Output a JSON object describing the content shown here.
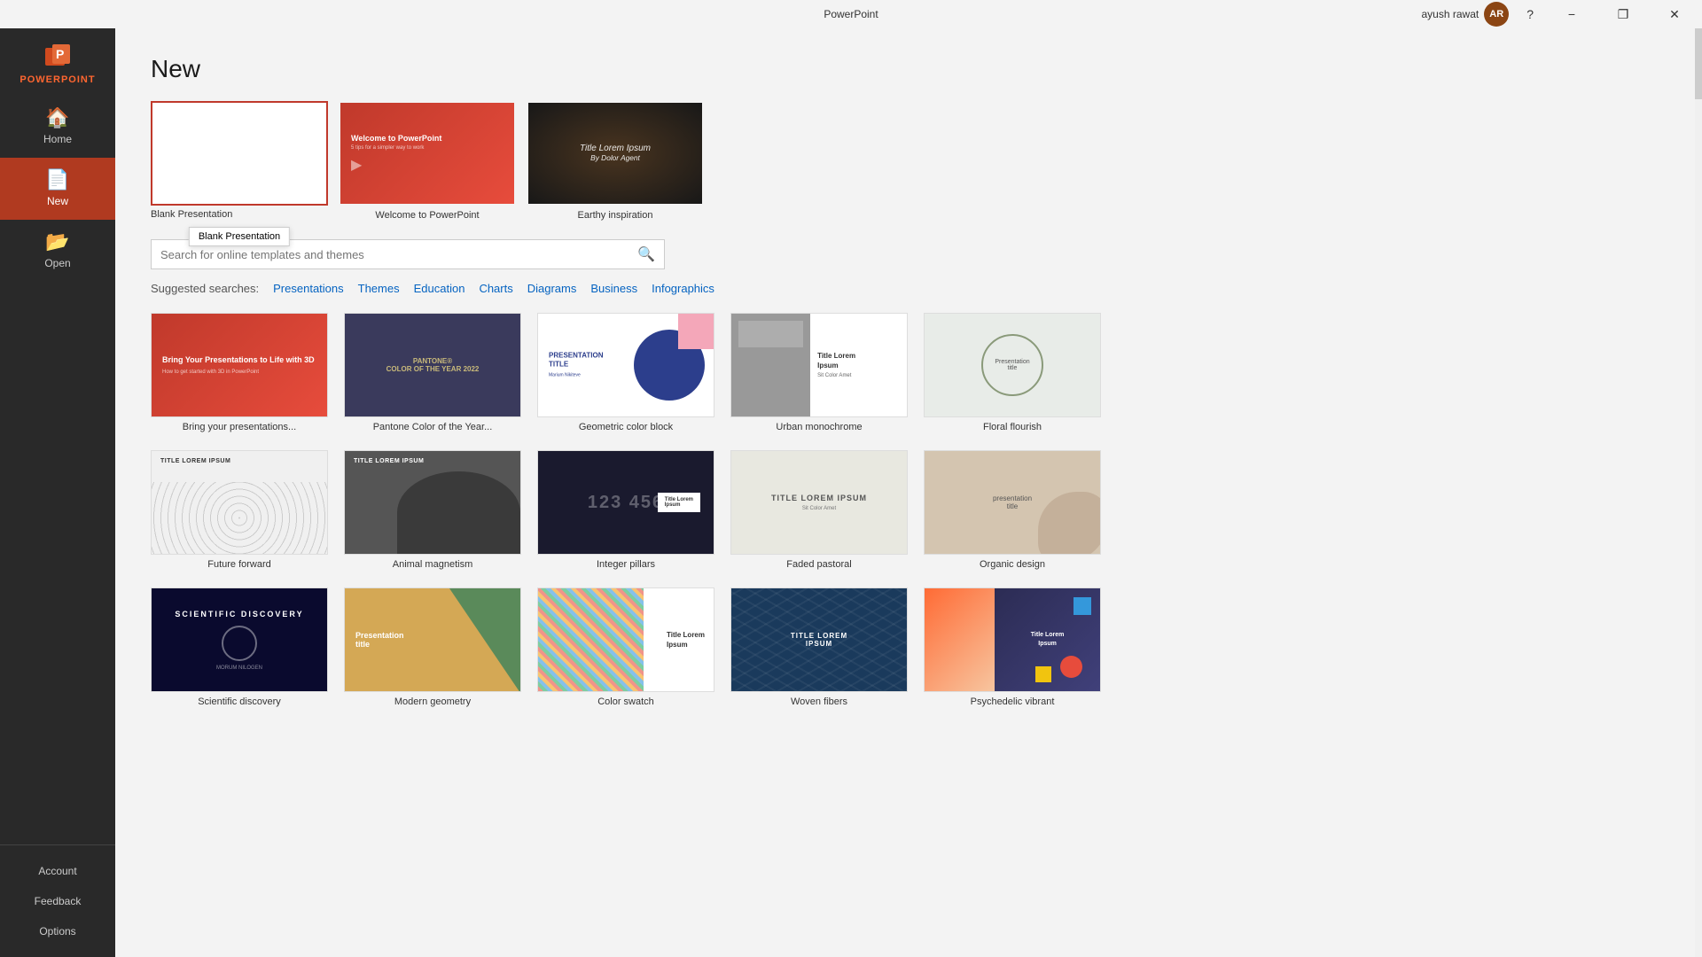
{
  "app": {
    "name": "PowerPoint",
    "title": "PowerPoint",
    "user": "ayush rawat",
    "user_initials": "AR"
  },
  "titlebar": {
    "help": "?",
    "minimize": "−",
    "restore": "❐",
    "close": "✕"
  },
  "sidebar": {
    "logo": "PowerPoint",
    "home_label": "Home",
    "new_label": "New",
    "open_label": "Open",
    "account_label": "Account",
    "feedback_label": "Feedback",
    "options_label": "Options"
  },
  "main": {
    "title": "New",
    "search_placeholder": "Search for online templates and themes",
    "search_icon": "🔍",
    "suggested_label": "Suggested searches:",
    "suggested_links": [
      "Presentations",
      "Themes",
      "Education",
      "Charts",
      "Diagrams",
      "Business",
      "Infographics"
    ]
  },
  "featured": [
    {
      "id": "blank",
      "label": "Blank Presentation",
      "tooltip": "Blank Presentation",
      "type": "blank"
    },
    {
      "id": "welcome",
      "label": "Welcome to PowerPoint",
      "type": "welcome"
    },
    {
      "id": "earthy",
      "label": "Earthy inspiration",
      "type": "earthy"
    }
  ],
  "templates_row1": [
    {
      "id": "bring",
      "label": "Bring your presentations...",
      "type": "bring"
    },
    {
      "id": "pantone",
      "label": "Pantone Color of the Year...",
      "type": "pantone"
    },
    {
      "id": "geometric",
      "label": "Geometric color block",
      "type": "geometric"
    },
    {
      "id": "urban",
      "label": "Urban monochrome",
      "type": "urban"
    },
    {
      "id": "floral",
      "label": "Floral flourish",
      "type": "floral"
    }
  ],
  "templates_row2": [
    {
      "id": "future",
      "label": "Future forward",
      "type": "future"
    },
    {
      "id": "animal",
      "label": "Animal magnetism",
      "type": "animal"
    },
    {
      "id": "integer",
      "label": "Integer pillars",
      "type": "integer"
    },
    {
      "id": "faded",
      "label": "Faded pastoral",
      "type": "faded"
    },
    {
      "id": "organic",
      "label": "Organic design",
      "type": "organic"
    }
  ],
  "templates_row3": [
    {
      "id": "scientific",
      "label": "Scientific discovery",
      "type": "scientific"
    },
    {
      "id": "modern",
      "label": "Modern geometry",
      "type": "modern"
    },
    {
      "id": "swatch",
      "label": "Color swatch",
      "type": "swatch"
    },
    {
      "id": "woven",
      "label": "Woven fibers",
      "type": "woven"
    },
    {
      "id": "psychedelic",
      "label": "Psychedelic vibrant",
      "type": "psychedelic"
    }
  ]
}
